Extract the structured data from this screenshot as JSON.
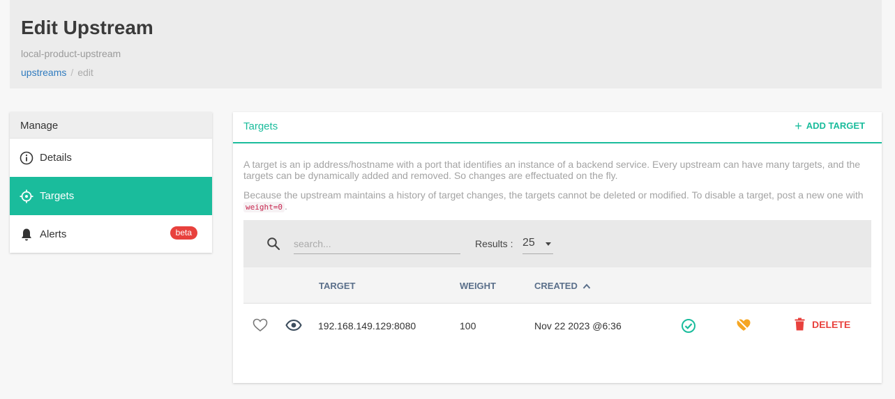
{
  "header": {
    "title": "Edit Upstream",
    "subtitle": "local-product-upstream",
    "breadcrumb": {
      "link": "upstreams",
      "separator": "/",
      "current": "edit"
    }
  },
  "sidebar": {
    "title": "Manage",
    "items": [
      {
        "label": "Details",
        "icon": "info-icon",
        "active": false
      },
      {
        "label": "Targets",
        "icon": "crosshair-icon",
        "active": true
      },
      {
        "label": "Alerts",
        "icon": "bell-icon",
        "active": false,
        "badge": "beta"
      }
    ]
  },
  "targets_panel": {
    "title": "Targets",
    "add_button": "ADD TARGET",
    "description_1": "A target is an ip address/hostname with a port that identifies an instance of a backend service. Every upstream can have many targets, and the targets can be dynamically added and removed. So changes are effectuated on the fly.",
    "description_2_prefix": "Because the upstream maintains a history of target changes, the targets cannot be deleted or modified. To disable a target, post a new one with",
    "description_2_code": "weight=0",
    "description_2_suffix": ".",
    "search": {
      "placeholder": "search...",
      "value": ""
    },
    "results": {
      "label": "Results :",
      "value": "25"
    },
    "columns": {
      "target": "TARGET",
      "weight": "WEIGHT",
      "created": "CREATED"
    },
    "rows": [
      {
        "target": "192.168.149.129:8080",
        "weight": "100",
        "created": "Nov 22 2023 @6:36",
        "delete_label": "DELETE"
      }
    ]
  },
  "colors": {
    "accent": "#1abc9c",
    "danger": "#e8413d",
    "warning": "#f5a623",
    "link": "#2f7bbf"
  }
}
